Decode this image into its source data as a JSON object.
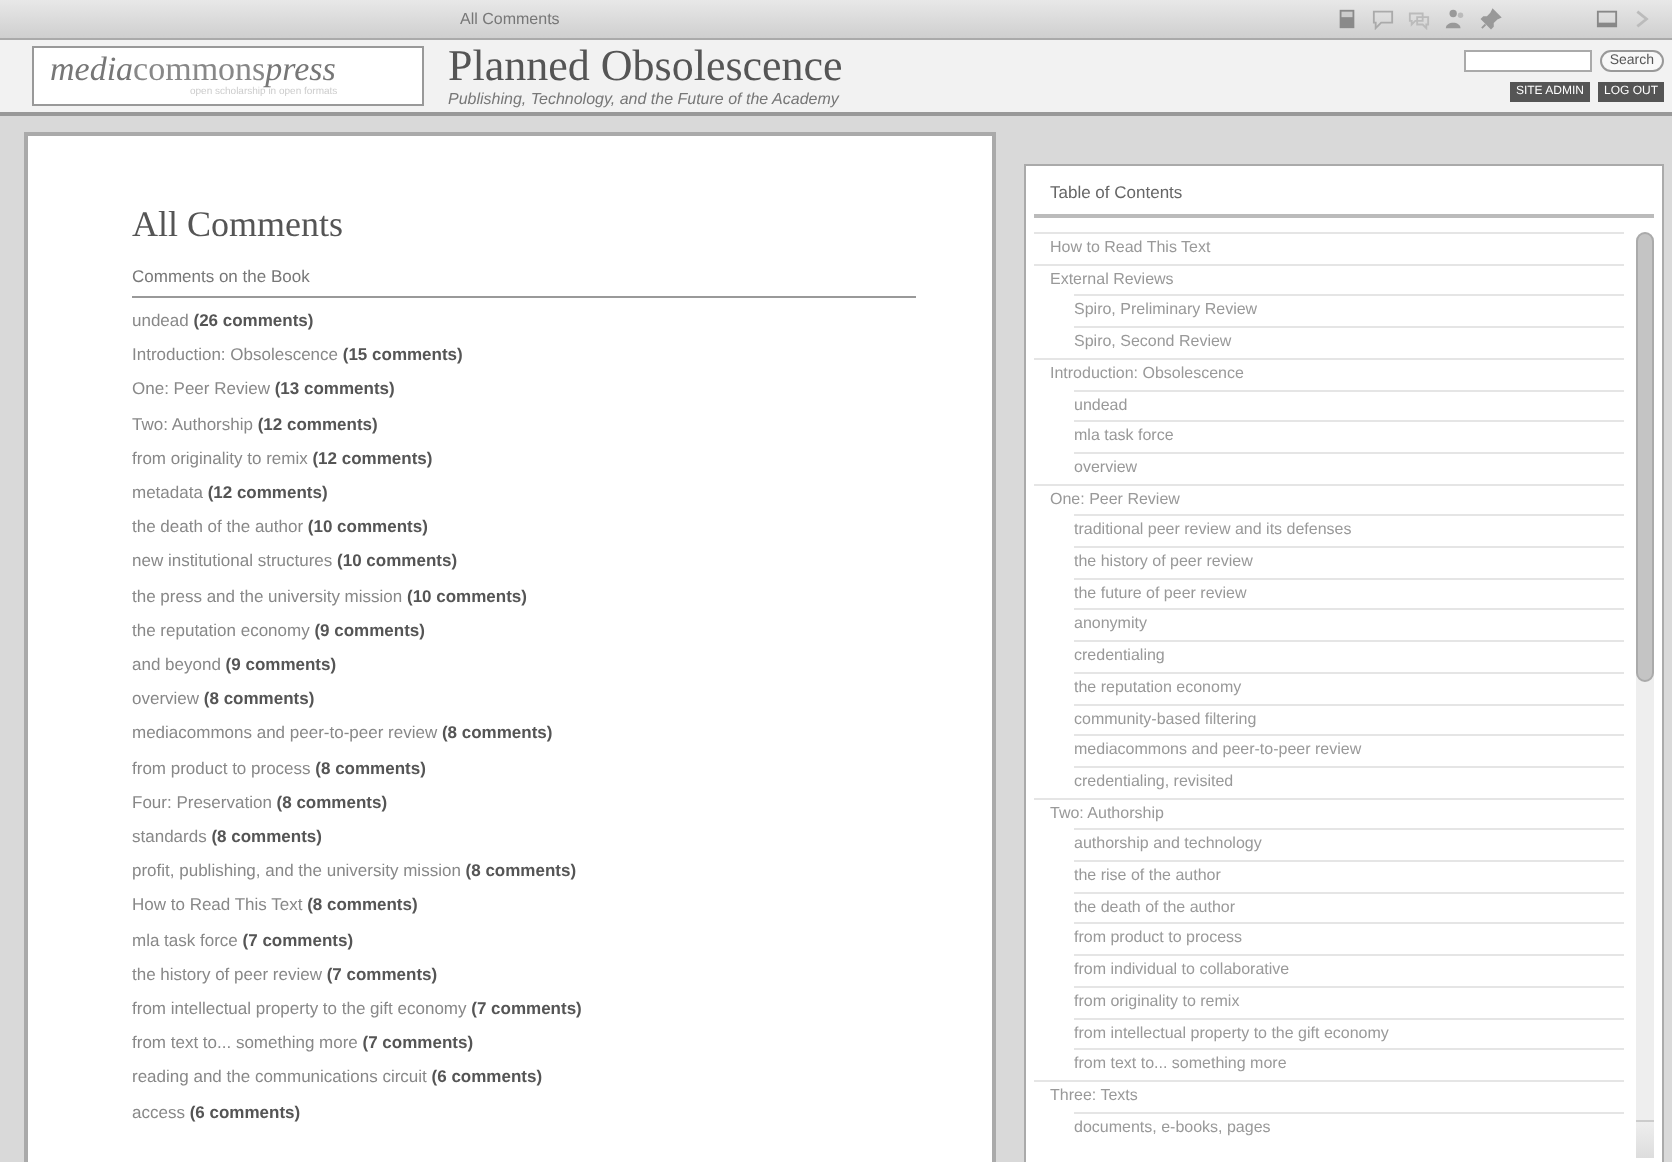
{
  "toolbar": {
    "title": "All Comments"
  },
  "header": {
    "logo": {
      "part_1": "media",
      "part_2": "commons",
      "part_3": "press",
      "tagline": "open scholarship in open formats"
    },
    "title": "Planned Obsolescence",
    "subtitle": "Publishing, Technology, and the Future of the Academy",
    "search": {
      "button": "Search"
    },
    "buttons": [
      "SITE ADMIN",
      "LOG OUT"
    ]
  },
  "main": {
    "heading": "All Comments",
    "subheading": "Comments on the Book",
    "comments": [
      {
        "title": "undead",
        "count": "(26 comments)"
      },
      {
        "title": "Introduction: Obsolescence",
        "count": "(15 comments)"
      },
      {
        "title": "One: Peer Review",
        "count": "(13 comments)"
      },
      {
        "title": "Two: Authorship",
        "count": "(12 comments)"
      },
      {
        "title": "from originality to remix",
        "count": "(12 comments)"
      },
      {
        "title": "metadata",
        "count": "(12 comments)"
      },
      {
        "title": "the death of the author",
        "count": "(10 comments)"
      },
      {
        "title": "new institutional structures",
        "count": "(10 comments)"
      },
      {
        "title": "the press and the university mission",
        "count": "(10 comments)"
      },
      {
        "title": "the reputation economy",
        "count": "(9 comments)"
      },
      {
        "title": "and beyond",
        "count": "(9 comments)"
      },
      {
        "title": "overview",
        "count": "(8 comments)"
      },
      {
        "title": "mediacommons and peer-to-peer review",
        "count": "(8 comments)"
      },
      {
        "title": "from product to process",
        "count": "(8 comments)"
      },
      {
        "title": "Four: Preservation",
        "count": "(8 comments)"
      },
      {
        "title": "standards",
        "count": "(8 comments)"
      },
      {
        "title": "profit, publishing, and the university mission",
        "count": "(8 comments)"
      },
      {
        "title": "How to Read This Text",
        "count": "(8 comments)"
      },
      {
        "title": "mla task force",
        "count": "(7 comments)"
      },
      {
        "title": "the history of peer review",
        "count": "(7 comments)"
      },
      {
        "title": "from intellectual property to the gift economy",
        "count": "(7 comments)"
      },
      {
        "title": "from text to... something more",
        "count": "(7 comments)"
      },
      {
        "title": "reading and the communications circuit",
        "count": "(6 comments)"
      },
      {
        "title": "access",
        "count": "(6 comments)"
      }
    ]
  },
  "toc": {
    "title": "Table of Contents",
    "items": [
      {
        "label": "How to Read This Text"
      },
      {
        "label": "External Reviews",
        "children": [
          {
            "label": "Spiro, Preliminary Review"
          },
          {
            "label": "Spiro, Second Review"
          }
        ]
      },
      {
        "label": "Introduction: Obsolescence",
        "children": [
          {
            "label": "undead"
          },
          {
            "label": "mla task force"
          },
          {
            "label": "overview"
          }
        ]
      },
      {
        "label": "One: Peer Review",
        "children": [
          {
            "label": "traditional peer review and its defenses"
          },
          {
            "label": "the history of peer review"
          },
          {
            "label": "the future of peer review"
          },
          {
            "label": "anonymity"
          },
          {
            "label": "credentialing"
          },
          {
            "label": "the reputation economy"
          },
          {
            "label": "community-based filtering"
          },
          {
            "label": "mediacommons and peer-to-peer review"
          },
          {
            "label": "credentialing, revisited"
          }
        ]
      },
      {
        "label": "Two: Authorship",
        "children": [
          {
            "label": "authorship and technology"
          },
          {
            "label": "the rise of the author"
          },
          {
            "label": "the death of the author"
          },
          {
            "label": "from product to process"
          },
          {
            "label": "from individual to collaborative"
          },
          {
            "label": "from originality to remix"
          },
          {
            "label": "from intellectual property to the gift economy"
          },
          {
            "label": "from text to... something more"
          }
        ]
      },
      {
        "label": "Three: Texts",
        "children": [
          {
            "label": "documents, e-books, pages"
          }
        ]
      }
    ]
  }
}
